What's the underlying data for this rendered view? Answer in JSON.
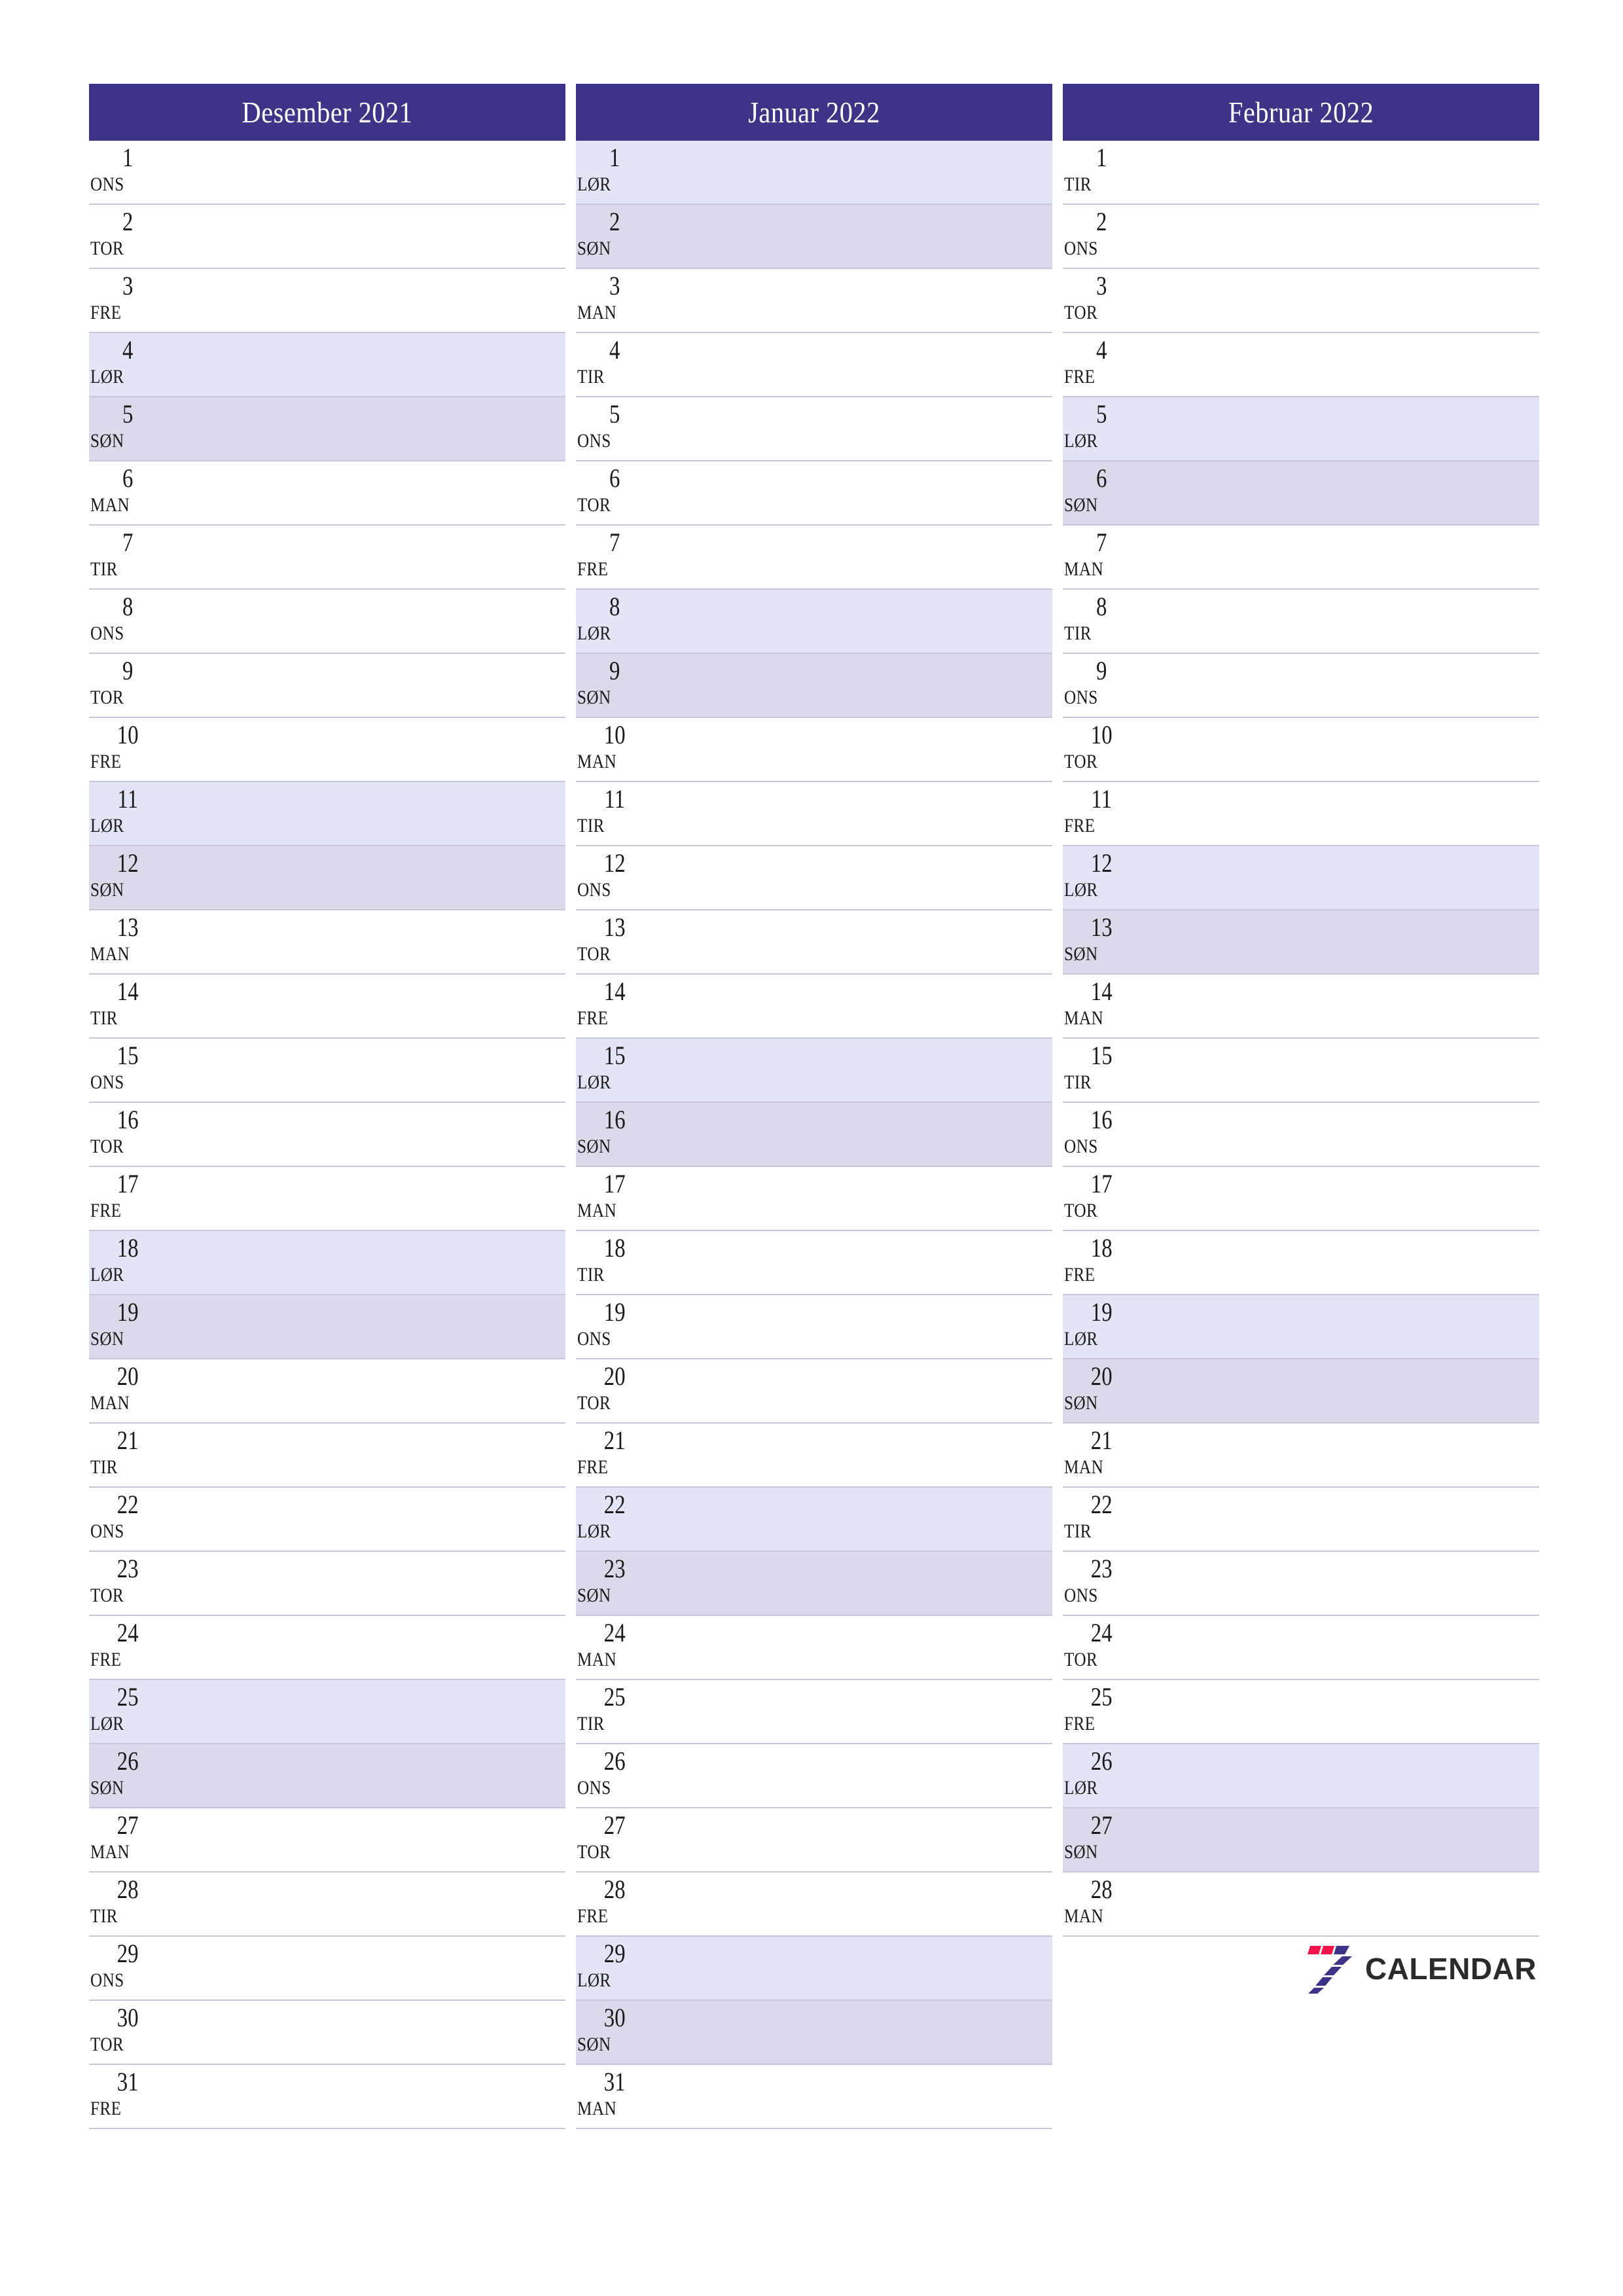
{
  "page": {
    "background": "#ffffff",
    "accent_header_color": "#3b3487",
    "saturday_color": "#e4e4f7",
    "sunday_color": "#dcd9ea",
    "separator_color": "#c8c5dd",
    "text_color": "#1a1a1a"
  },
  "brand": {
    "name": "CALENDAR",
    "mark_digit": "7",
    "mark_colors": {
      "red": "#f4154a",
      "indigo": "#3b3487"
    },
    "wordmark_color": "#2b2b2b"
  },
  "months": [
    {
      "title": "Desember 2021",
      "month_name": "Desember",
      "year": "2021",
      "days": [
        {
          "num": "1",
          "weekday": "ONS",
          "type": "weekday"
        },
        {
          "num": "2",
          "weekday": "TOR",
          "type": "weekday"
        },
        {
          "num": "3",
          "weekday": "FRE",
          "type": "weekday"
        },
        {
          "num": "4",
          "weekday": "LØR",
          "type": "saturday"
        },
        {
          "num": "5",
          "weekday": "SØN",
          "type": "sunday"
        },
        {
          "num": "6",
          "weekday": "MAN",
          "type": "weekday"
        },
        {
          "num": "7",
          "weekday": "TIR",
          "type": "weekday"
        },
        {
          "num": "8",
          "weekday": "ONS",
          "type": "weekday"
        },
        {
          "num": "9",
          "weekday": "TOR",
          "type": "weekday"
        },
        {
          "num": "10",
          "weekday": "FRE",
          "type": "weekday"
        },
        {
          "num": "11",
          "weekday": "LØR",
          "type": "saturday"
        },
        {
          "num": "12",
          "weekday": "SØN",
          "type": "sunday"
        },
        {
          "num": "13",
          "weekday": "MAN",
          "type": "weekday"
        },
        {
          "num": "14",
          "weekday": "TIR",
          "type": "weekday"
        },
        {
          "num": "15",
          "weekday": "ONS",
          "type": "weekday"
        },
        {
          "num": "16",
          "weekday": "TOR",
          "type": "weekday"
        },
        {
          "num": "17",
          "weekday": "FRE",
          "type": "weekday"
        },
        {
          "num": "18",
          "weekday": "LØR",
          "type": "saturday"
        },
        {
          "num": "19",
          "weekday": "SØN",
          "type": "sunday"
        },
        {
          "num": "20",
          "weekday": "MAN",
          "type": "weekday"
        },
        {
          "num": "21",
          "weekday": "TIR",
          "type": "weekday"
        },
        {
          "num": "22",
          "weekday": "ONS",
          "type": "weekday"
        },
        {
          "num": "23",
          "weekday": "TOR",
          "type": "weekday"
        },
        {
          "num": "24",
          "weekday": "FRE",
          "type": "weekday"
        },
        {
          "num": "25",
          "weekday": "LØR",
          "type": "saturday"
        },
        {
          "num": "26",
          "weekday": "SØN",
          "type": "sunday"
        },
        {
          "num": "27",
          "weekday": "MAN",
          "type": "weekday"
        },
        {
          "num": "28",
          "weekday": "TIR",
          "type": "weekday"
        },
        {
          "num": "29",
          "weekday": "ONS",
          "type": "weekday"
        },
        {
          "num": "30",
          "weekday": "TOR",
          "type": "weekday"
        },
        {
          "num": "31",
          "weekday": "FRE",
          "type": "weekday"
        }
      ]
    },
    {
      "title": "Januar 2022",
      "month_name": "Januar",
      "year": "2022",
      "days": [
        {
          "num": "1",
          "weekday": "LØR",
          "type": "saturday"
        },
        {
          "num": "2",
          "weekday": "SØN",
          "type": "sunday"
        },
        {
          "num": "3",
          "weekday": "MAN",
          "type": "weekday"
        },
        {
          "num": "4",
          "weekday": "TIR",
          "type": "weekday"
        },
        {
          "num": "5",
          "weekday": "ONS",
          "type": "weekday"
        },
        {
          "num": "6",
          "weekday": "TOR",
          "type": "weekday"
        },
        {
          "num": "7",
          "weekday": "FRE",
          "type": "weekday"
        },
        {
          "num": "8",
          "weekday": "LØR",
          "type": "saturday"
        },
        {
          "num": "9",
          "weekday": "SØN",
          "type": "sunday"
        },
        {
          "num": "10",
          "weekday": "MAN",
          "type": "weekday"
        },
        {
          "num": "11",
          "weekday": "TIR",
          "type": "weekday"
        },
        {
          "num": "12",
          "weekday": "ONS",
          "type": "weekday"
        },
        {
          "num": "13",
          "weekday": "TOR",
          "type": "weekday"
        },
        {
          "num": "14",
          "weekday": "FRE",
          "type": "weekday"
        },
        {
          "num": "15",
          "weekday": "LØR",
          "type": "saturday"
        },
        {
          "num": "16",
          "weekday": "SØN",
          "type": "sunday"
        },
        {
          "num": "17",
          "weekday": "MAN",
          "type": "weekday"
        },
        {
          "num": "18",
          "weekday": "TIR",
          "type": "weekday"
        },
        {
          "num": "19",
          "weekday": "ONS",
          "type": "weekday"
        },
        {
          "num": "20",
          "weekday": "TOR",
          "type": "weekday"
        },
        {
          "num": "21",
          "weekday": "FRE",
          "type": "weekday"
        },
        {
          "num": "22",
          "weekday": "LØR",
          "type": "saturday"
        },
        {
          "num": "23",
          "weekday": "SØN",
          "type": "sunday"
        },
        {
          "num": "24",
          "weekday": "MAN",
          "type": "weekday"
        },
        {
          "num": "25",
          "weekday": "TIR",
          "type": "weekday"
        },
        {
          "num": "26",
          "weekday": "ONS",
          "type": "weekday"
        },
        {
          "num": "27",
          "weekday": "TOR",
          "type": "weekday"
        },
        {
          "num": "28",
          "weekday": "FRE",
          "type": "weekday"
        },
        {
          "num": "29",
          "weekday": "LØR",
          "type": "saturday"
        },
        {
          "num": "30",
          "weekday": "SØN",
          "type": "sunday"
        },
        {
          "num": "31",
          "weekday": "MAN",
          "type": "weekday"
        }
      ]
    },
    {
      "title": "Februar 2022",
      "month_name": "Februar",
      "year": "2022",
      "days": [
        {
          "num": "1",
          "weekday": "TIR",
          "type": "weekday"
        },
        {
          "num": "2",
          "weekday": "ONS",
          "type": "weekday"
        },
        {
          "num": "3",
          "weekday": "TOR",
          "type": "weekday"
        },
        {
          "num": "4",
          "weekday": "FRE",
          "type": "weekday"
        },
        {
          "num": "5",
          "weekday": "LØR",
          "type": "saturday"
        },
        {
          "num": "6",
          "weekday": "SØN",
          "type": "sunday"
        },
        {
          "num": "7",
          "weekday": "MAN",
          "type": "weekday"
        },
        {
          "num": "8",
          "weekday": "TIR",
          "type": "weekday"
        },
        {
          "num": "9",
          "weekday": "ONS",
          "type": "weekday"
        },
        {
          "num": "10",
          "weekday": "TOR",
          "type": "weekday"
        },
        {
          "num": "11",
          "weekday": "FRE",
          "type": "weekday"
        },
        {
          "num": "12",
          "weekday": "LØR",
          "type": "saturday"
        },
        {
          "num": "13",
          "weekday": "SØN",
          "type": "sunday"
        },
        {
          "num": "14",
          "weekday": "MAN",
          "type": "weekday"
        },
        {
          "num": "15",
          "weekday": "TIR",
          "type": "weekday"
        },
        {
          "num": "16",
          "weekday": "ONS",
          "type": "weekday"
        },
        {
          "num": "17",
          "weekday": "TOR",
          "type": "weekday"
        },
        {
          "num": "18",
          "weekday": "FRE",
          "type": "weekday"
        },
        {
          "num": "19",
          "weekday": "LØR",
          "type": "saturday"
        },
        {
          "num": "20",
          "weekday": "SØN",
          "type": "sunday"
        },
        {
          "num": "21",
          "weekday": "MAN",
          "type": "weekday"
        },
        {
          "num": "22",
          "weekday": "TIR",
          "type": "weekday"
        },
        {
          "num": "23",
          "weekday": "ONS",
          "type": "weekday"
        },
        {
          "num": "24",
          "weekday": "TOR",
          "type": "weekday"
        },
        {
          "num": "25",
          "weekday": "FRE",
          "type": "weekday"
        },
        {
          "num": "26",
          "weekday": "LØR",
          "type": "saturday"
        },
        {
          "num": "27",
          "weekday": "SØN",
          "type": "sunday"
        },
        {
          "num": "28",
          "weekday": "MAN",
          "type": "weekday"
        }
      ]
    }
  ]
}
